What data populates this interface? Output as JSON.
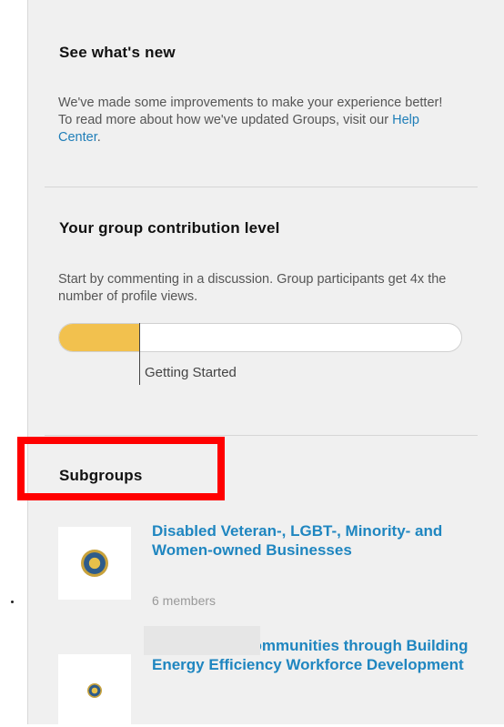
{
  "whats_new": {
    "title": "See what's new",
    "body_prefix": "We've made some improvements to make your experience better! To read more about how we've updated Groups, visit our ",
    "link_text": "Help Center",
    "body_suffix": "."
  },
  "contribution": {
    "title": "Your group contribution level",
    "body": "Start by commenting in a discussion. Group participants get 4x the number of profile views.",
    "progress_fraction": 0.2,
    "level_label": "Getting Started",
    "fill_color": "#f2c14e"
  },
  "subgroups": {
    "title": "Subgroups",
    "items": [
      {
        "name": "Disabled Veteran-, LGBT-, Minority- and Women-owned Businesses",
        "members": "6 members",
        "logo_icon": "seal-logo-icon"
      },
      {
        "name": "n California Communities through Building Energy Efficiency Workforce Development",
        "members": "",
        "logo_icon": "seal-logo-icon"
      }
    ]
  },
  "colors": {
    "link": "#1f7eb8",
    "subgroup_link": "#1f86c0",
    "highlight": "#ff0000",
    "panel_bg": "#f0f0f0"
  }
}
